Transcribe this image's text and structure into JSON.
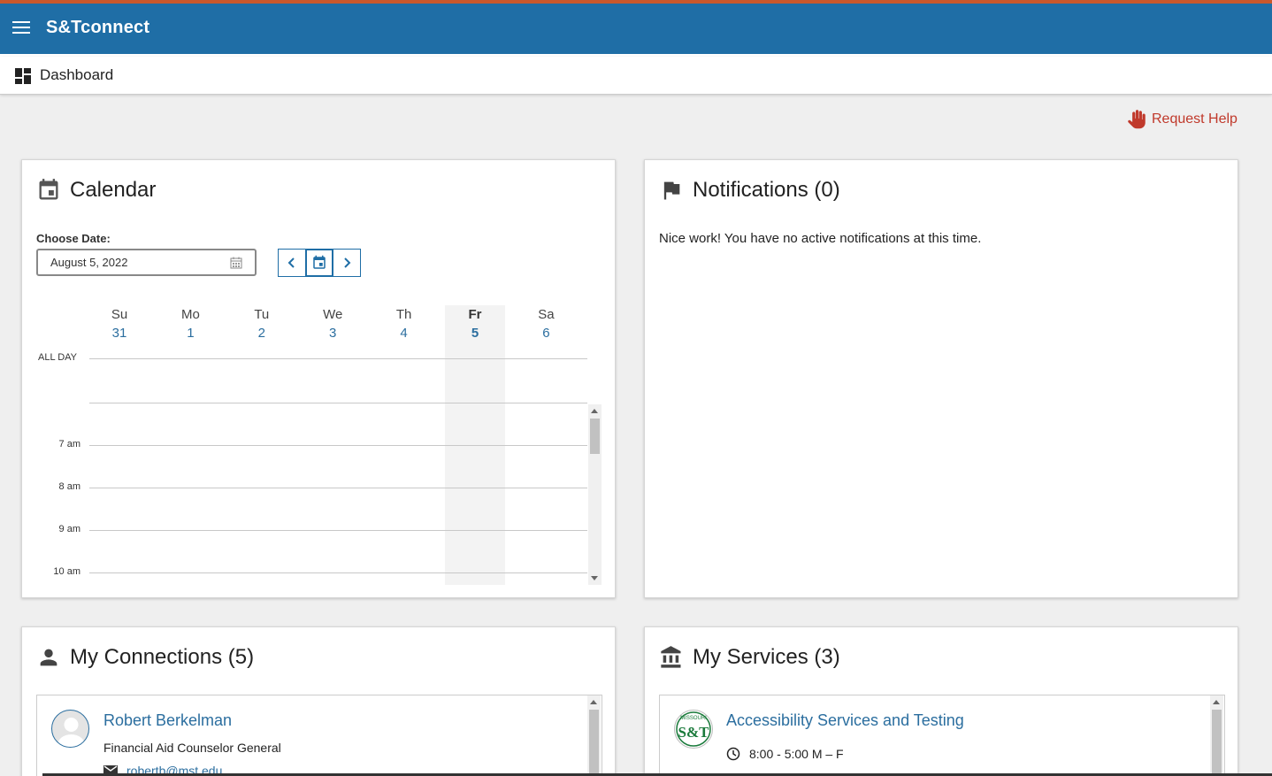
{
  "app": {
    "title": "S&Tconnect"
  },
  "subnav": {
    "label": "Dashboard"
  },
  "help": {
    "label": "Request Help"
  },
  "calendar": {
    "title": "Calendar",
    "choose_label": "Choose Date:",
    "date_value": "August 5, 2022",
    "all_day": "ALL DAY",
    "days": [
      {
        "name": "Su",
        "date": "31"
      },
      {
        "name": "Mo",
        "date": "1"
      },
      {
        "name": "Tu",
        "date": "2"
      },
      {
        "name": "We",
        "date": "3"
      },
      {
        "name": "Th",
        "date": "4"
      },
      {
        "name": "Fr",
        "date": "5"
      },
      {
        "name": "Sa",
        "date": "6"
      }
    ],
    "today_index": 5,
    "hours": [
      "7 am",
      "8 am",
      "9 am",
      "10 am"
    ]
  },
  "notifications": {
    "title": "Notifications (0)",
    "message": "Nice work! You have no active notifications at this time."
  },
  "connections": {
    "title": "My Connections (5)",
    "items": [
      {
        "name": "Robert Berkelman",
        "role": "Financial Aid Counselor General",
        "email": "robertb@mst.edu"
      }
    ]
  },
  "services": {
    "title": "My Services (3)",
    "items": [
      {
        "name": "Accessibility Services and Testing",
        "hours": "8:00 - 5:00 M – F",
        "logo_text": "S&T",
        "logo_caption": "MISSOURI"
      }
    ]
  },
  "colors": {
    "brand": "#1f6ea6",
    "accent": "#c9582c",
    "link": "#2b6e9f",
    "help": "#c0392b"
  }
}
